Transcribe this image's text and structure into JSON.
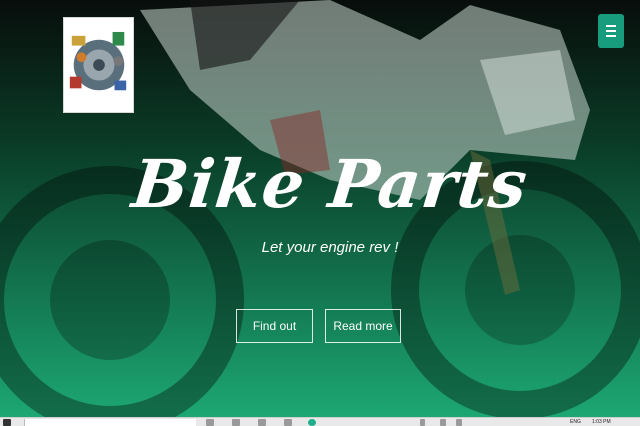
{
  "hero": {
    "title": "Bike Parts",
    "tagline": "Let your engine rev !",
    "buttons": {
      "find_out": "Find out",
      "read_more": "Read more"
    }
  },
  "header": {
    "logo_icon": "bike-parts-logo",
    "menu_icon": "hamburger-menu-icon"
  },
  "colors": {
    "accent": "#179c7e",
    "gradient_top": "#0a0f0c",
    "gradient_bottom": "#1eaf78"
  },
  "taskbar": {
    "language": "ENG",
    "time": "1:03 PM"
  }
}
